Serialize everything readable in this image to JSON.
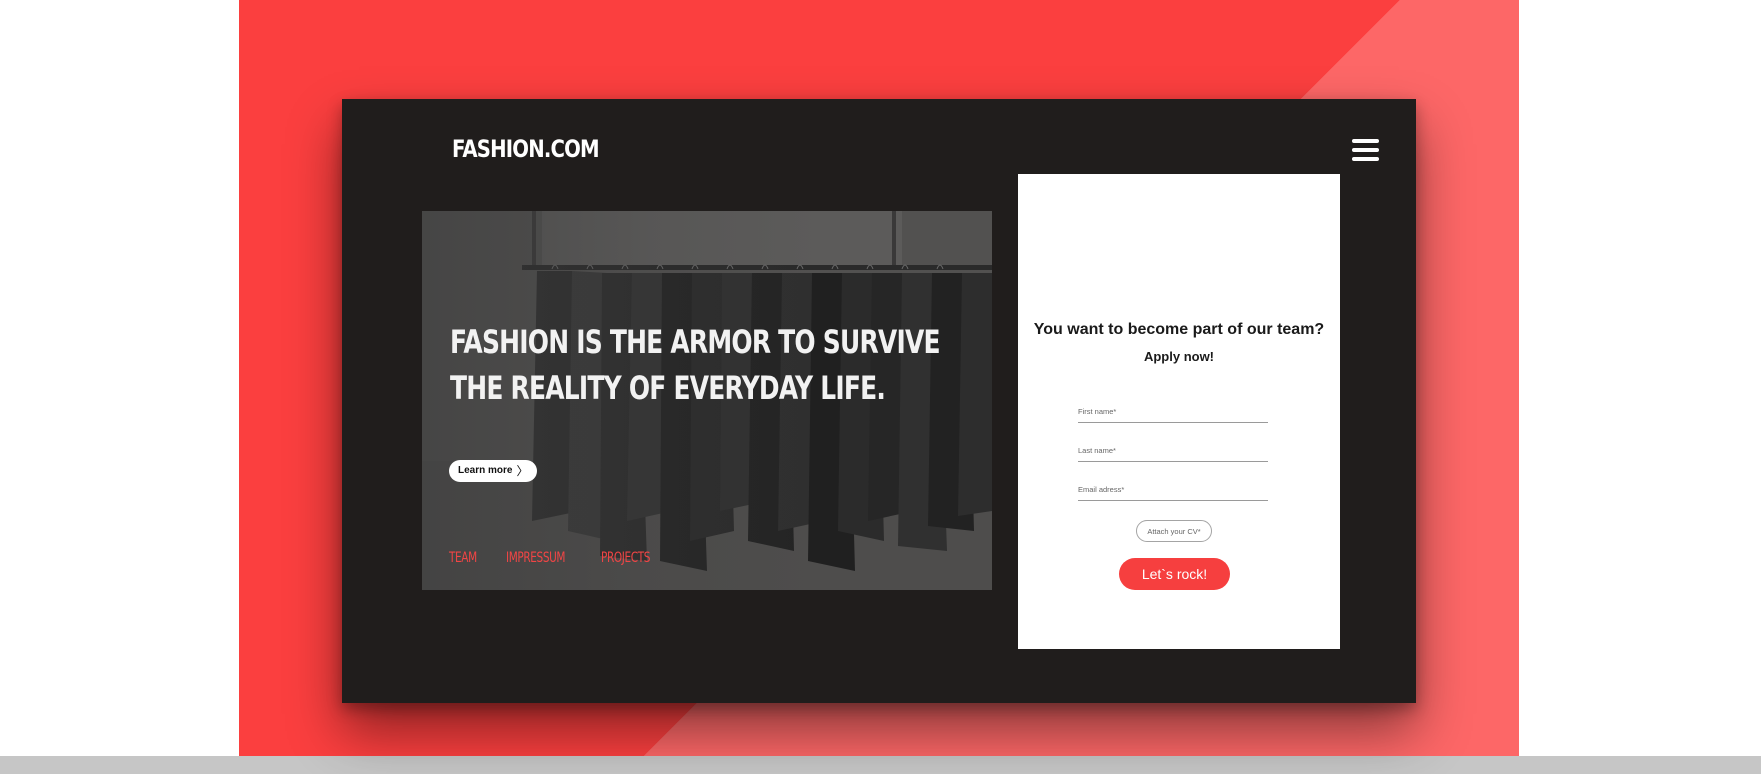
{
  "brand": {
    "logo_text": "FASHION.COM"
  },
  "header": {
    "menu_icon": "hamburger-menu-icon"
  },
  "hero": {
    "headline_line1": "FASHION IS THE ARMOR TO SURVIVE",
    "headline_line2": "THE REALITY OF EVERYDAY LIFE.",
    "cta_label": "Learn more",
    "cta_icon": "chevron-right-icon",
    "nav": [
      "TEAM",
      "IMPRESSUM",
      "PROJECTS"
    ],
    "image_subject": "clothing-rack-image"
  },
  "form": {
    "title": "You want to become part of our team?",
    "subtitle": "Apply now!",
    "first_name_placeholder": "First name*",
    "last_name_placeholder": "Last name*",
    "email_placeholder": "Email adress*",
    "attach_label": "Attach your CV*",
    "submit_label": "Let`s rock!"
  },
  "colors": {
    "accent": "#f63f3f",
    "background_red": "#fb3f3f",
    "background_red_light": "#fd6767",
    "panel_dark": "#201d1c",
    "nav_red": "#f24545"
  }
}
